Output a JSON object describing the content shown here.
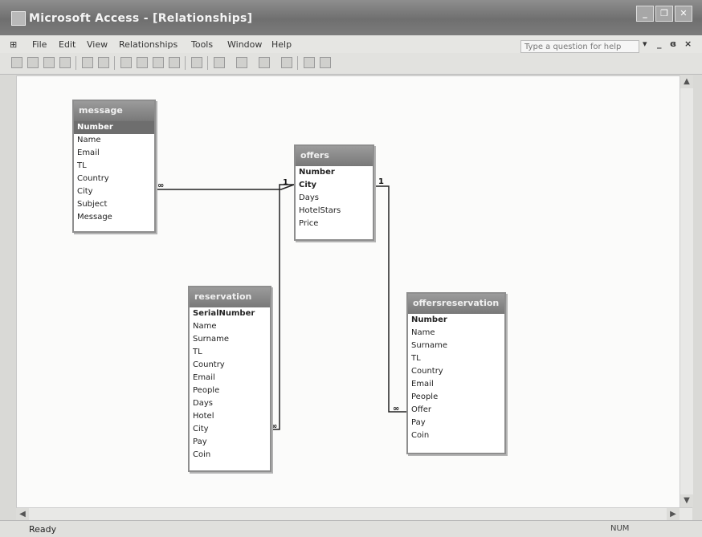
{
  "window": {
    "title": "Microsoft Access - [Relationships]",
    "minimize_glyph": "_",
    "restore_glyph": "❐",
    "close_glyph": "✕"
  },
  "menu": {
    "items": [
      "File",
      "Edit",
      "View",
      "Relationships",
      "Tools",
      "Window",
      "Help"
    ],
    "help_placeholder": "Type a question for help",
    "mdi_controls": [
      "▾",
      "_",
      "ɞ",
      "×"
    ]
  },
  "toolbar": {
    "icons": [
      "new-icon",
      "open-icon",
      "save-icon",
      "print-icon",
      "preview-icon",
      "spelling-icon",
      "cut-icon",
      "copy-icon",
      "paste-icon",
      "format-painter-icon",
      "undo-icon",
      "show-table-icon",
      "show-direct-icon",
      "show-all-icon",
      "delete-icon",
      "new-object-icon",
      "help-icon"
    ]
  },
  "tables": {
    "message": {
      "title": "message",
      "fields": [
        "Number",
        "Name",
        "Email",
        "TL",
        "Country",
        "City",
        "Subject",
        "Message"
      ]
    },
    "offers": {
      "title": "offers",
      "fields": [
        "Number",
        "City",
        "Days",
        "HotelStars",
        "Price"
      ]
    },
    "reservation": {
      "title": "reservation",
      "fields": [
        "SerialNumber",
        "Name",
        "Surname",
        "TL",
        "Country",
        "Email",
        "People",
        "Days",
        "Hotel",
        "City",
        "Pay",
        "Coin"
      ]
    },
    "offersreservation": {
      "title": "offersreservation",
      "fields": [
        "Number",
        "Name",
        "Surname",
        "TL",
        "Country",
        "Email",
        "People",
        "Offer",
        "Pay",
        "Coin"
      ]
    }
  },
  "relationships": [
    {
      "from": "message",
      "to": "offers",
      "many_label": "∞",
      "one_label": "1"
    },
    {
      "from": "reservation",
      "to": "offers",
      "many_label": "∞",
      "one_label": "1"
    },
    {
      "from": "offersreservation",
      "to": "offers",
      "many_label": "∞",
      "one_label": "1"
    }
  ],
  "status": {
    "text": "Ready",
    "num": "NUM"
  },
  "colors": {
    "title_bar": "#7c7c7c",
    "table_header": "#8a8a8a",
    "workspace": "#fbfbfa"
  }
}
